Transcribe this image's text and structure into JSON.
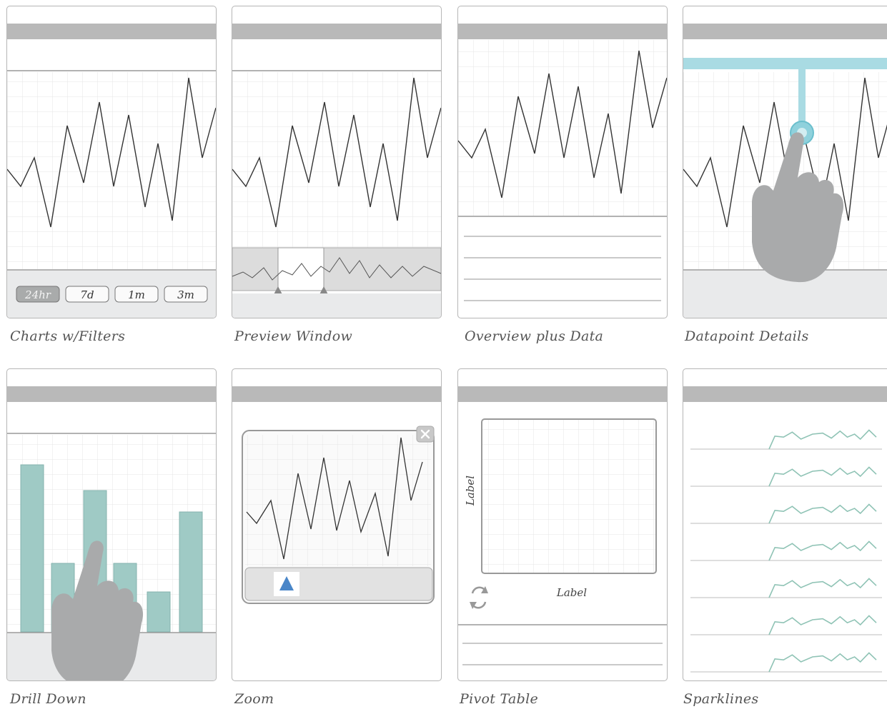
{
  "panels": [
    {
      "id": "charts-filters",
      "caption": "Charts w/Filters",
      "filters": [
        "24hr",
        "7d",
        "1m",
        "3m"
      ],
      "active_filter": "24hr"
    },
    {
      "id": "preview-window",
      "caption": "Preview Window"
    },
    {
      "id": "overview-plus-data",
      "caption": "Overview plus Data"
    },
    {
      "id": "datapoint-details",
      "caption": "Datapoint Details"
    },
    {
      "id": "drill-down",
      "caption": "Drill Down"
    },
    {
      "id": "zoom",
      "caption": "Zoom"
    },
    {
      "id": "pivot-table",
      "caption": "Pivot Table",
      "y_label": "Label",
      "x_label": "Label"
    },
    {
      "id": "sparklines",
      "caption": "Sparklines"
    }
  ],
  "colors": {
    "header_bar": "#b9b9b9",
    "grid": "#e6e6e6",
    "line": "#333333",
    "teal": "#9fcac5",
    "highlight": "#a9dbe3",
    "hand": "#a9aaab",
    "zoom_marker": "#4a86c8",
    "sparkline": "#8fc3b5"
  }
}
